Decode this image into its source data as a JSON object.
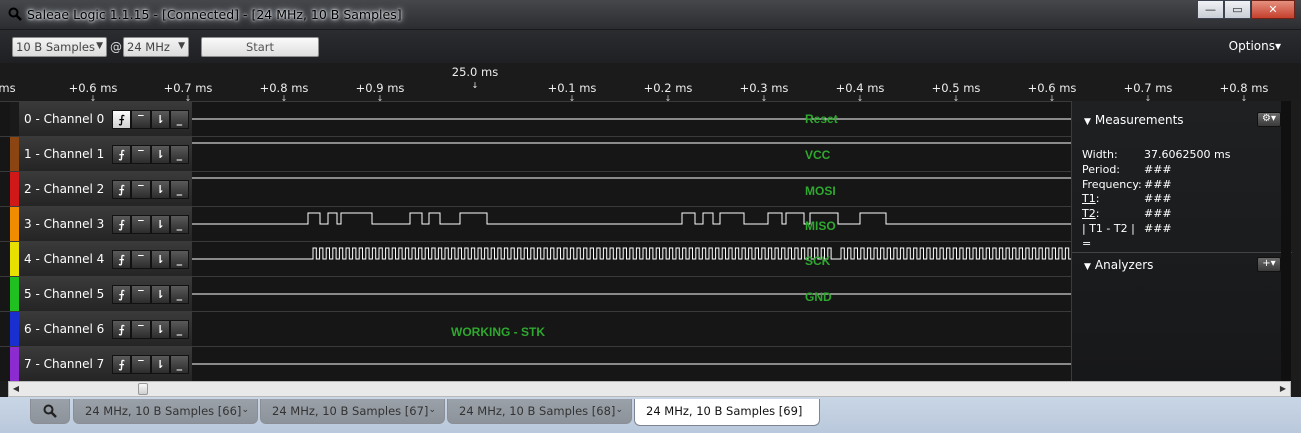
{
  "window": {
    "title": "Saleae Logic 1.1.15 - [Connected] - [24 MHz, 10 B Samples]",
    "minimize": "—",
    "restore": "▭",
    "close": "✕"
  },
  "toolbar": {
    "samples": "10 B Samples",
    "at": "@",
    "rate": "24 MHz",
    "start": "Start",
    "options": "Options▾"
  },
  "ruler": {
    "edge": "ms",
    "center": "25.0 ms",
    "ticks": [
      "+0.6 ms",
      "+0.7 ms",
      "+0.8 ms",
      "+0.9 ms",
      "+0.1 ms",
      "+0.2 ms",
      "+0.3 ms",
      "+0.4 ms",
      "+0.5 ms",
      "+0.6 ms",
      "+0.7 ms",
      "+0.8 ms"
    ]
  },
  "channels": [
    {
      "label": "0 - Channel 0",
      "color": "#1a1a1a",
      "tag": "Reset",
      "trace": "low"
    },
    {
      "label": "1 - Channel 1",
      "color": "#8b4513",
      "tag": "VCC",
      "trace": "high"
    },
    {
      "label": "2 - Channel 2",
      "color": "#d01818",
      "tag": "MOSI",
      "trace": "high"
    },
    {
      "label": "3 - Channel 3",
      "color": "#f08c00",
      "tag": "MISO",
      "trace": "miso"
    },
    {
      "label": "4 - Channel 4",
      "color": "#e8e000",
      "tag": "SCK",
      "trace": "clock"
    },
    {
      "label": "5 - Channel 5",
      "color": "#20c020",
      "tag": "GND",
      "trace": "low"
    },
    {
      "label": "6 - Channel 6",
      "color": "#1a2fd0",
      "tag": "WORKING - STK",
      "trace": "none"
    },
    {
      "label": "7 - Channel 7",
      "color": "#8c2cd0",
      "tag": "",
      "trace": "low"
    }
  ],
  "trigger_glyphs": [
    "⨍",
    "‾",
    "⇂",
    "_"
  ],
  "measurements": {
    "title": "Measurements",
    "rows": [
      {
        "key": "Width:",
        "value": "37.6062500 ms",
        "underline": false
      },
      {
        "key": "Period:",
        "value": "###",
        "underline": false
      },
      {
        "key": "Frequency:",
        "value": "###",
        "underline": false
      },
      {
        "key": "T1",
        "suffix": ":",
        "value": "###",
        "underline": true
      },
      {
        "key": "T2",
        "suffix": ":",
        "value": "###",
        "underline": true
      },
      {
        "key": "| T1 - T2 | =",
        "value": "###",
        "underline": false
      }
    ]
  },
  "analyzers": {
    "title": "Analyzers",
    "add": "+▾"
  },
  "scroll": {
    "left": "◀",
    "right": "▶"
  },
  "tabs": [
    {
      "label": "24 MHz, 10 B Samples [66]",
      "active": false
    },
    {
      "label": "24 MHz, 10 B Samples [67]",
      "active": false
    },
    {
      "label": "24 MHz, 10 B Samples [68]",
      "active": false
    },
    {
      "label": "24 MHz, 10 B Samples [69]",
      "active": true
    }
  ],
  "tab_chevron": "⌄"
}
